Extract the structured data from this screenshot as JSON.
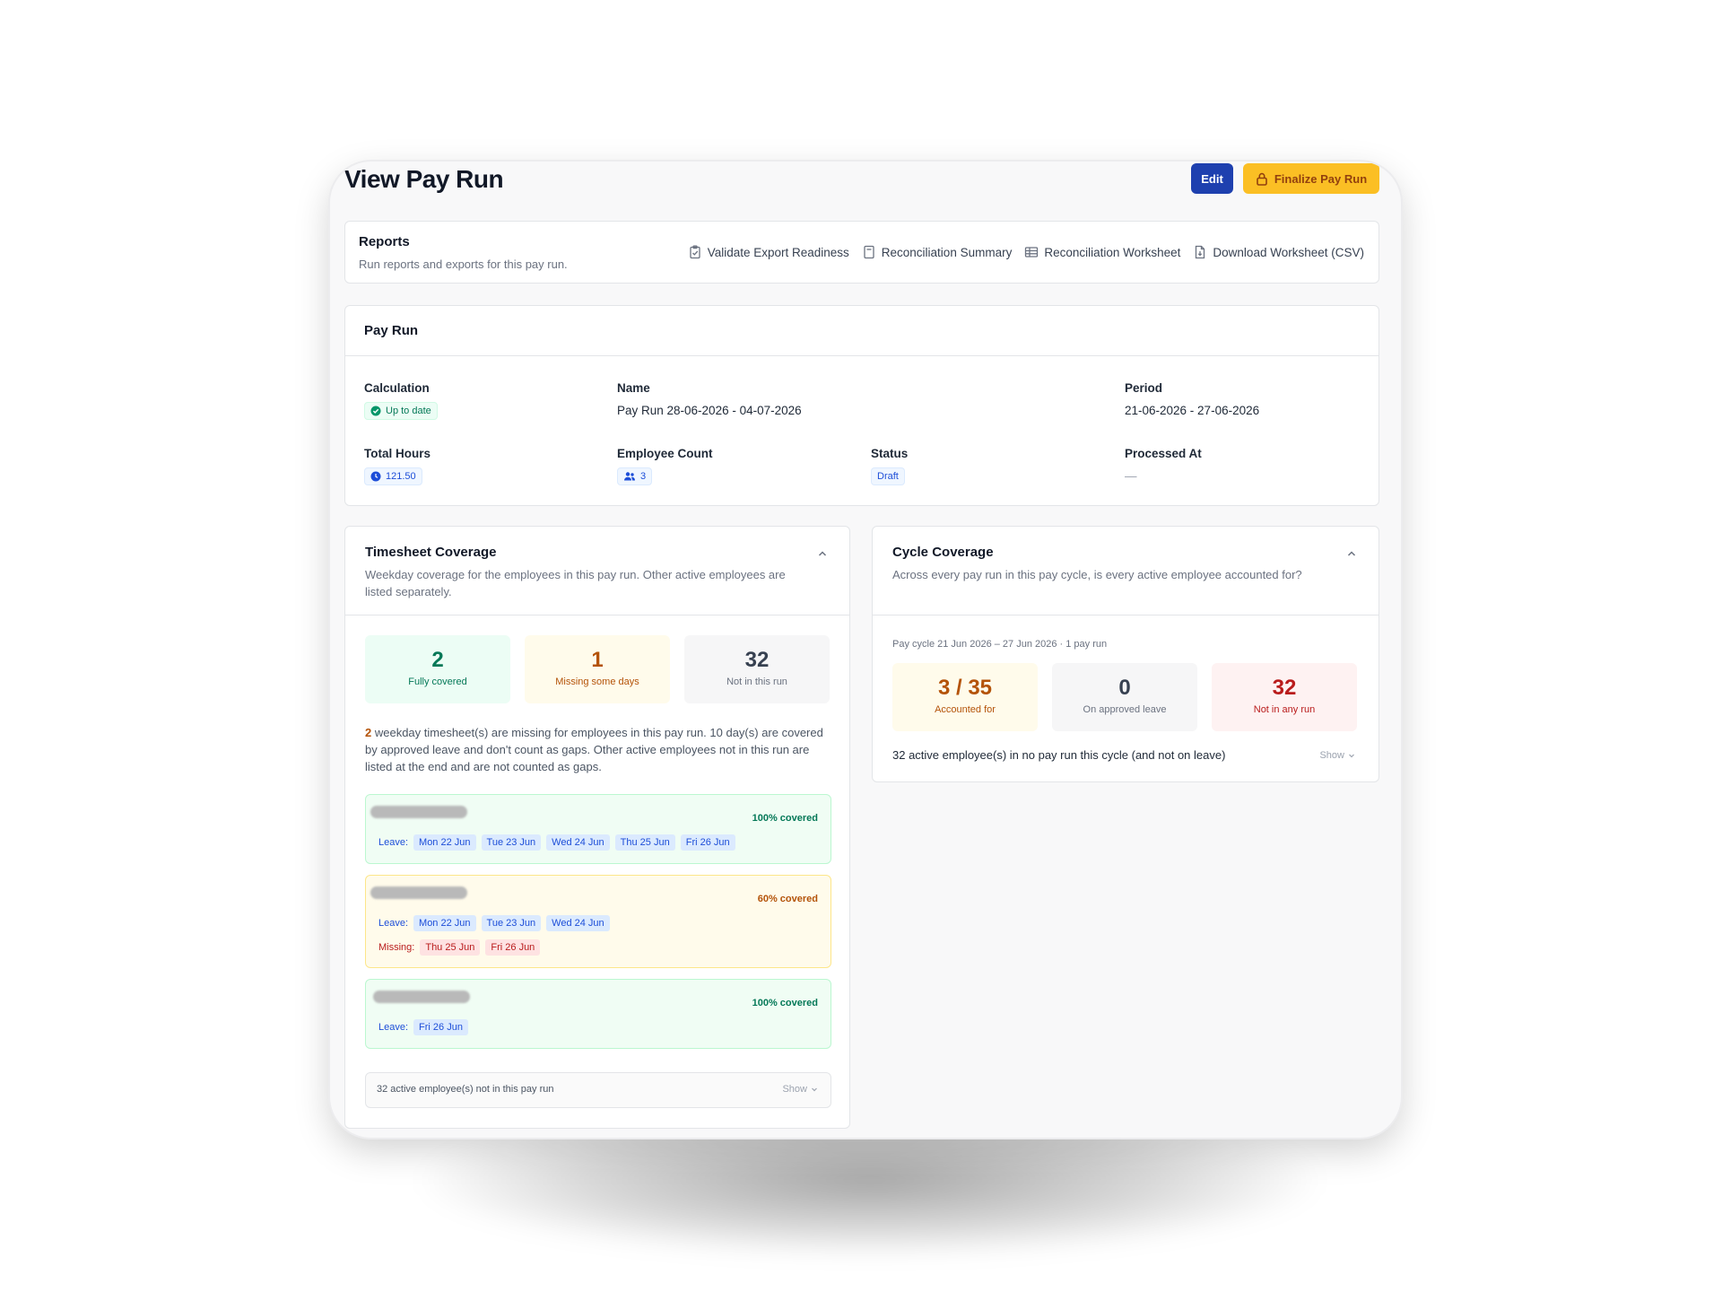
{
  "page": {
    "title": "View Pay Run"
  },
  "actions": {
    "edit": "Edit",
    "finalize": "Finalize Pay Run"
  },
  "reports": {
    "title": "Reports",
    "subtitle": "Run reports and exports for this pay run.",
    "links": [
      {
        "label": "Validate Export Readiness",
        "icon": "clipboard-check-icon"
      },
      {
        "label": "Reconciliation Summary",
        "icon": "document-icon"
      },
      {
        "label": "Reconciliation Worksheet",
        "icon": "table-icon"
      },
      {
        "label": "Download Worksheet (CSV)",
        "icon": "file-download-icon"
      }
    ]
  },
  "pay_run": {
    "title": "Pay Run",
    "calculation": {
      "label": "Calculation",
      "value": "Up to date"
    },
    "name": {
      "label": "Name",
      "value": "Pay Run 28-06-2026 - 04-07-2026"
    },
    "period": {
      "label": "Period",
      "value": "21-06-2026 - 27-06-2026"
    },
    "total_hours": {
      "label": "Total Hours",
      "value": "121.50"
    },
    "employee_count": {
      "label": "Employee Count",
      "value": "3"
    },
    "status": {
      "label": "Status",
      "value": "Draft"
    },
    "processed_at": {
      "label": "Processed At",
      "value": "—"
    }
  },
  "timesheet_coverage": {
    "title": "Timesheet Coverage",
    "description": "Weekday coverage for the employees in this pay run. Other active employees are listed separately.",
    "stats": [
      {
        "value": "2",
        "caption": "Fully covered"
      },
      {
        "value": "1",
        "caption": "Missing some days"
      },
      {
        "value": "32",
        "caption": "Not in this run"
      }
    ],
    "note_count": "2",
    "note_text": " weekday timesheet(s) are missing for employees in this pay run. 10 day(s) are covered by approved leave and don't count as gaps. Other active employees not in this run are listed at the end and are not counted as gaps.",
    "leave_label": "Leave:",
    "missing_label": "Missing:",
    "employees": [
      {
        "coverage": "100% covered",
        "leave": [
          "Mon 22 Jun",
          "Tue 23 Jun",
          "Wed 24 Jun",
          "Thu 25 Jun",
          "Fri 26 Jun"
        ],
        "missing": []
      },
      {
        "coverage": "60% covered",
        "leave": [
          "Mon 22 Jun",
          "Tue 23 Jun",
          "Wed 24 Jun"
        ],
        "missing": [
          "Thu 25 Jun",
          "Fri 26 Jun"
        ]
      },
      {
        "coverage": "100% covered",
        "leave": [
          "Fri 26 Jun"
        ],
        "missing": []
      }
    ],
    "others_text": "32 active employee(s) not in this pay run",
    "show_label": "Show"
  },
  "cycle_coverage": {
    "title": "Cycle Coverage",
    "description": "Across every pay run in this pay cycle, is every active employee accounted for?",
    "meta": "Pay cycle 21 Jun 2026 – 27 Jun 2026 · 1 pay run",
    "stats": [
      {
        "value": "3 / 35",
        "caption": "Accounted for"
      },
      {
        "value": "0",
        "caption": "On approved leave"
      },
      {
        "value": "32",
        "caption": "Not in any run"
      }
    ],
    "unaccounted_text": "32 active employee(s) in no pay run this cycle (and not on leave)",
    "show_label": "Show"
  }
}
